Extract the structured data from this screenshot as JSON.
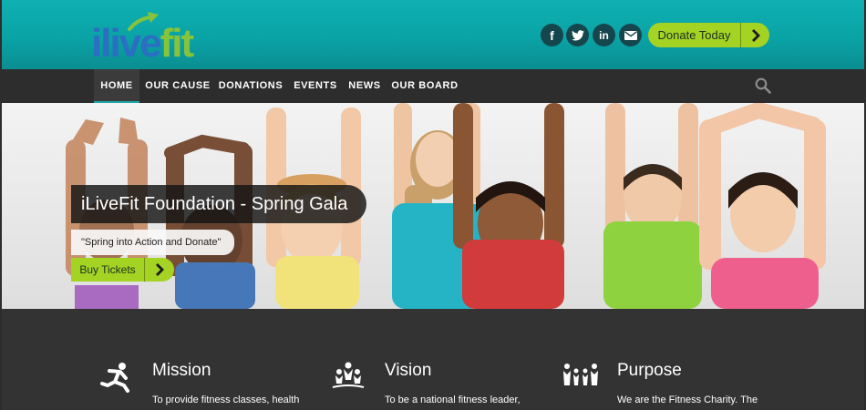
{
  "header": {
    "logo": {
      "text_left": "ilive",
      "text_right": "fit"
    },
    "social": [
      {
        "name": "facebook",
        "glyph": "f"
      },
      {
        "name": "twitter",
        "glyph": "twitter-bird"
      },
      {
        "name": "linkedin",
        "glyph": "in"
      },
      {
        "name": "email",
        "glyph": "envelope"
      }
    ],
    "donate_label": "Donate Today"
  },
  "nav": {
    "items": [
      "HOME",
      "OUR CAUSE",
      "DONATIONS",
      "EVENTS",
      "NEWS",
      "OUR BOARD"
    ],
    "active": "HOME"
  },
  "hero": {
    "title": "iLiveFit Foundation - Spring Gala",
    "quote": "\"Spring into Action and Donate\"",
    "cta_label": "Buy Tickets"
  },
  "features": [
    {
      "icon": "running-person-icon",
      "title": "Mission",
      "text": "To provide fitness classes, health"
    },
    {
      "icon": "group-people-icon",
      "title": "Vision",
      "text": "To be a national fitness leader,"
    },
    {
      "icon": "family-icon",
      "title": "Purpose",
      "text": "We are the Fitness Charity. The"
    }
  ],
  "colors": {
    "header_teal": "#0aa3a6",
    "nav_dark": "#2d2d2d",
    "accent_green": "#a4d324",
    "logo_blue": "#2a6fc1",
    "logo_green": "#86c33a",
    "footer_dark": "#333333"
  }
}
